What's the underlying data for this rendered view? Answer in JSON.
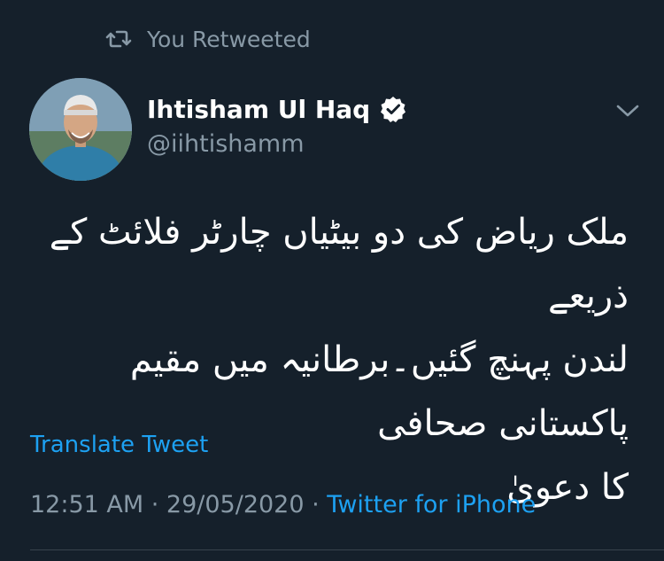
{
  "retweet": {
    "label": "You Retweeted",
    "icon": "retweet-icon"
  },
  "author": {
    "name": "Ihtisham Ul Haq",
    "handle": "@iihtishamm",
    "verified": true
  },
  "tweet": {
    "text": "ملک ریاض کی دو بیٹیاں چارٹر فلائٹ کے ذریعے\nلندن پہنچ گئیں۔برطانیہ میں مقیم پاکستانی صحافی\nکا دعویٰ"
  },
  "translate_label": "Translate Tweet",
  "meta": {
    "time": "12:51 AM",
    "separator": " · ",
    "date": "29/05/2020",
    "source": "Twitter for iPhone"
  },
  "colors": {
    "background": "#15202b",
    "secondary_text": "#8899a6",
    "accent": "#1da1f2"
  }
}
